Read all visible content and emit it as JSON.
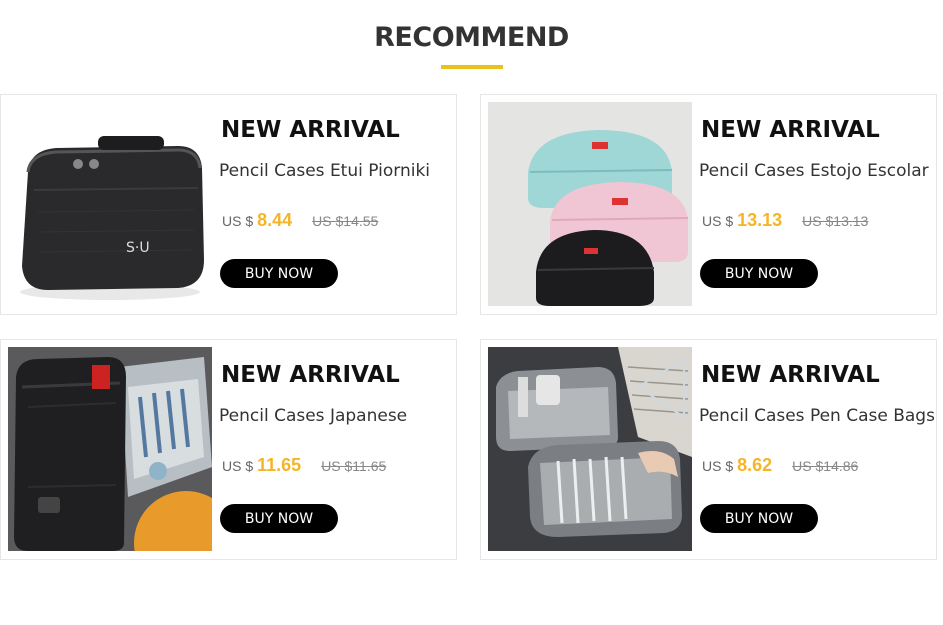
{
  "section": {
    "title": "RECOMMEND",
    "accent_color": "#e8c21a"
  },
  "colors": {
    "price": "#f5b528",
    "button_bg": "#000000",
    "button_text": "#ffffff"
  },
  "products": [
    {
      "headline": "NEW ARRIVAL",
      "name": "Pencil Cases Etui Piorniki",
      "currency": "US $",
      "price": "8.44",
      "old_price": "US $14.55",
      "button": "BUY NOW",
      "image": "black-zip-pencil-case-photo"
    },
    {
      "headline": "NEW ARRIVAL",
      "name": "Pencil Cases Estojo Escolar",
      "currency": "US $",
      "price": "13.13",
      "old_price": "US $13.13",
      "button": "BUY NOW",
      "image": "stacked-pastel-pouches-photo"
    },
    {
      "headline": "NEW ARRIVAL",
      "name": "Pencil Cases Japanese",
      "currency": "US $",
      "price": "11.65",
      "old_price": "US $11.65",
      "button": "BUY NOW",
      "image": "open-black-pencil-case-photo"
    },
    {
      "headline": "NEW ARRIVAL",
      "name": "Pencil Cases Pen Case Bags",
      "currency": "US $",
      "price": "8.62",
      "old_price": "US $14.86",
      "button": "BUY NOW",
      "image": "grey-pen-case-bag-photo"
    }
  ]
}
